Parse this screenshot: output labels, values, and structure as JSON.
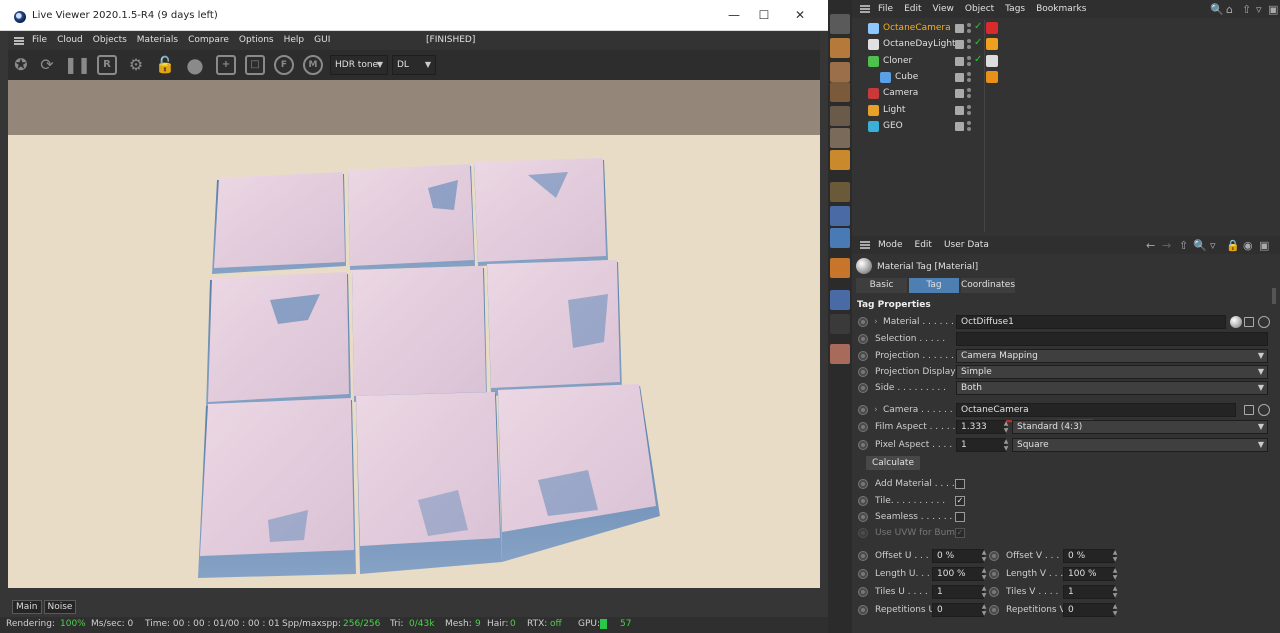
{
  "viewer": {
    "title": "Live Viewer 2020.1.5-R4 (9 days left)",
    "menu": [
      "File",
      "Cloud",
      "Objects",
      "Materials",
      "Compare",
      "Options",
      "Help",
      "GUI"
    ],
    "status": "[FINISHED]",
    "tonemap_select": "HDR tone",
    "kernel_select": "DL",
    "toolbar_letters": {
      "r": "R",
      "f": "F",
      "m": "M"
    },
    "bottom_tabs": [
      "Main",
      "Noise"
    ],
    "statusbar": {
      "rendering_label": "Rendering:",
      "rendering_value": "100%",
      "ms_label": "Ms/sec: 0",
      "time_label": "Time: 00 : 00 : 01/00 : 00 : 01",
      "spp_label": "Spp/maxspp:",
      "spp_value": "256/256",
      "tri_label": "Tri:",
      "tri_value": "0/43k",
      "mesh_label": "Mesh:",
      "mesh_value": "9",
      "hair_label": "Hair:",
      "hair_value": "0",
      "rtx_label": "RTX:",
      "rtx_value": "off",
      "gpu_label": "GPU:",
      "gpu_value": "57"
    }
  },
  "object_manager": {
    "menu": [
      "File",
      "Edit",
      "View",
      "Object",
      "Tags",
      "Bookmarks"
    ],
    "objects": [
      {
        "name": "OctaneCamera",
        "active": true,
        "indent": 0,
        "icon_color": "#8fc8ff",
        "tag_color": "#d92b2b",
        "check": true
      },
      {
        "name": "OctaneDayLight",
        "active": false,
        "indent": 0,
        "icon_color": "#e0e0e0",
        "tag_color": "#f0a020",
        "check": true
      },
      {
        "name": "Cloner",
        "active": false,
        "indent": 0,
        "icon_color": "#4ec04e",
        "tag_color": "#dddddd",
        "check": true
      },
      {
        "name": "Cube",
        "active": false,
        "indent": 1,
        "icon_color": "#5aa0e6",
        "tag_color": "#e8901a",
        "check": false
      },
      {
        "name": "Camera",
        "active": false,
        "indent": 0,
        "icon_color": "#c83a3a",
        "tag_color": "",
        "check": false
      },
      {
        "name": "Light",
        "active": false,
        "indent": 0,
        "icon_color": "#e8a02a",
        "tag_color": "",
        "check": false
      },
      {
        "name": "GEO",
        "active": false,
        "indent": 0,
        "icon_color": "#3ab0d8",
        "tag_color": "",
        "check": false
      }
    ]
  },
  "attribute_manager": {
    "menu": [
      "Mode",
      "Edit",
      "User Data"
    ],
    "title": "Material Tag [Material]",
    "tabs": [
      "Basic",
      "Tag",
      "Coordinates"
    ],
    "active_tab": "Tag",
    "section": "Tag Properties",
    "material": {
      "label": "Material . . . . . .",
      "value": "OctDiffuse1"
    },
    "selection": {
      "label": "Selection . . . . .",
      "value": ""
    },
    "projection": {
      "label": "Projection . . . . . .",
      "value": "Camera Mapping"
    },
    "projection_display": {
      "label": "Projection Display",
      "value": "Simple"
    },
    "side": {
      "label": "Side . . . . . . . . .",
      "value": "Both"
    },
    "camera": {
      "label": "Camera . . . . . . .",
      "value": "OctaneCamera"
    },
    "film_aspect": {
      "label": "Film Aspect . . . . .",
      "value": "1.333",
      "preset": "Standard (4:3)"
    },
    "pixel_aspect": {
      "label": "Pixel Aspect . . . .",
      "value": "1",
      "preset": "Square"
    },
    "calculate_label": "Calculate",
    "add_material": {
      "label": "Add Material . . . .",
      "checked": false
    },
    "tile": {
      "label": "Tile. . . . . . . . . .",
      "checked": true,
      "mark": "✓"
    },
    "seamless": {
      "label": "Seamless . . . . . .",
      "checked": false
    },
    "use_uvw": {
      "label": "Use UVW for Bump",
      "checked": true,
      "mark": "✓"
    },
    "offset_u": {
      "label": "Offset U . . .",
      "value": "0 %"
    },
    "offset_v": {
      "label": "Offset V . . .",
      "value": "0 %"
    },
    "length_u": {
      "label": "Length U. . .",
      "value": "100 %"
    },
    "length_v": {
      "label": "Length V . . .",
      "value": "100 %"
    },
    "tiles_u": {
      "label": "Tiles U . . . .",
      "value": "1"
    },
    "tiles_v": {
      "label": "Tiles V . . . .",
      "value": "1"
    },
    "repetitions_u": {
      "label": "Repetitions U",
      "value": "0"
    },
    "repetitions_v": {
      "label": "Repetitions V",
      "value": "0"
    }
  },
  "colors": {
    "accent_blue": "#4e7fb3",
    "active_object": "#f5b021",
    "annotation_red": "#d32828",
    "status_green": "#4cd04c"
  }
}
